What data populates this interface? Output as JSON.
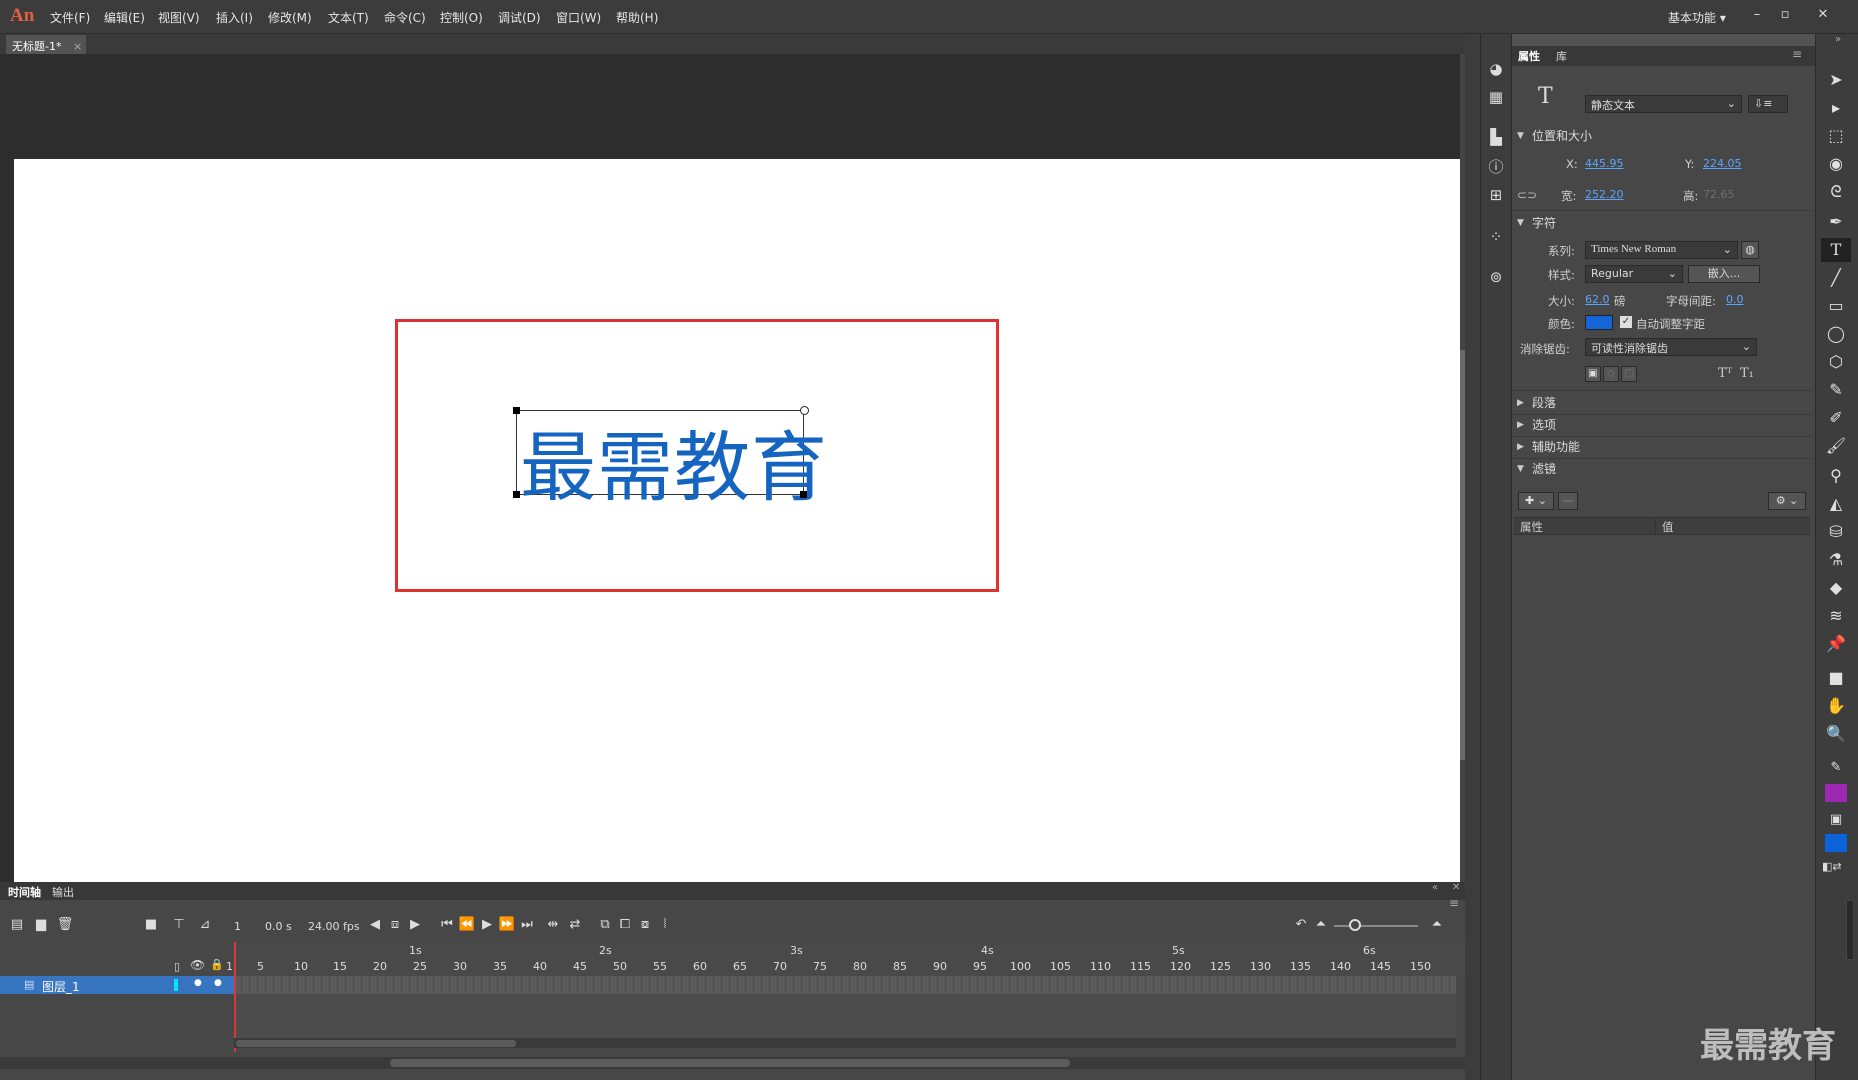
{
  "app": {
    "logo": "An",
    "workspace": "基本功能 ▾"
  },
  "menu": [
    "文件(F)",
    "编辑(E)",
    "视图(V)",
    "插入(I)",
    "修改(M)",
    "文本(T)",
    "命令(C)",
    "控制(O)",
    "调试(D)",
    "窗口(W)",
    "帮助(H)"
  ],
  "document": {
    "tab_title": "无标题-1*",
    "close_glyph": "×"
  },
  "stage": {
    "text": "最需教育",
    "text_color": "#1565c0",
    "rect_color": "#e03030"
  },
  "properties": {
    "tabs": [
      "属性",
      "库"
    ],
    "text_type": "静态文本",
    "sections": {
      "position_size": "位置和大小",
      "character": "字符",
      "paragraph": "段落",
      "options": "选项",
      "accessibility": "辅助功能",
      "filters": "滤镜"
    },
    "x_label": "X:",
    "x_value": "445.95",
    "y_label": "Y:",
    "y_value": "224.05",
    "w_label": "宽:",
    "w_value": "252.20",
    "h_label": "高:",
    "h_value": "72.65",
    "family_label": "系列:",
    "family_value": "Times New Roman",
    "style_label": "样式:",
    "style_value": "Regular",
    "embed_label": "嵌入...",
    "size_label": "大小:",
    "size_value": "62.0",
    "size_unit": "磅",
    "spacing_label": "字母间距:",
    "spacing_value": "0.0",
    "color_label": "颜色:",
    "color_value": "#1565d8",
    "autokern_label": "自动调整字距",
    "antialias_label": "消除锯齿:",
    "antialias_value": "可读性消除锯齿",
    "filter_cols": [
      "属性",
      "值"
    ]
  },
  "timeline": {
    "tabs": [
      "时间轴",
      "输出"
    ],
    "frame": "1",
    "time": "0.0 s",
    "fps": "24.00 fps",
    "layer_name": "图层_1",
    "seconds": [
      "1s",
      "2s",
      "3s",
      "4s",
      "5s",
      "6s"
    ],
    "frame_ticks": [
      "1",
      "5",
      "10",
      "15",
      "20",
      "25",
      "30",
      "35",
      "40",
      "45",
      "50",
      "55",
      "60",
      "65",
      "70",
      "75",
      "80",
      "85",
      "90",
      "95",
      "100",
      "105",
      "110",
      "115",
      "120",
      "125",
      "130",
      "135",
      "140",
      "145",
      "150"
    ]
  },
  "toolbar": {
    "fill_color": "#9c27b0",
    "stroke_color": "#0a63d8"
  },
  "watermark": "最需教育"
}
